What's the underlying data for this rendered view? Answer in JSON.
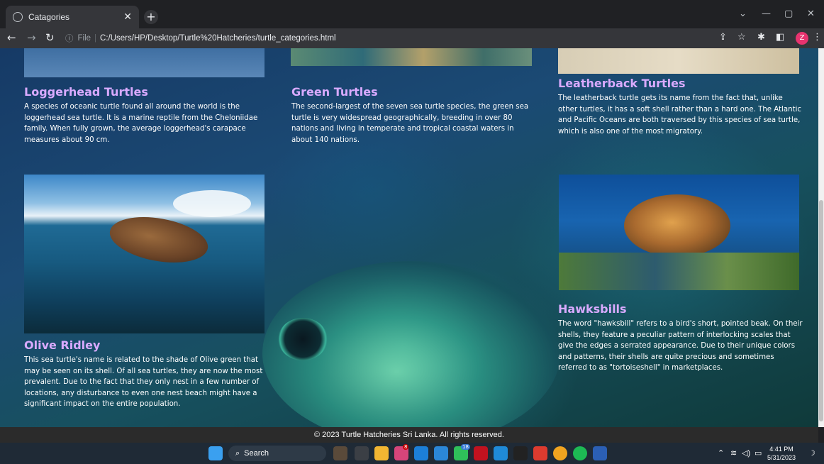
{
  "browser": {
    "tab_title": "Catagories",
    "new_tab_label": "+",
    "url_scheme": "File",
    "url": "C:/Users/HP/Desktop/Turtle%20Hatcheries/turtle_categories.html",
    "profile_initial": "Z"
  },
  "categories": {
    "loggerhead": {
      "title": "Loggerhead Turtles",
      "text": "A species of oceanic turtle found all around the world is the loggerhead sea turtle. It is a marine reptile from the Cheloniidae family. When fully grown, the average loggerhead's carapace measures about 90 cm."
    },
    "green": {
      "title": "Green Turtles",
      "text": "The second-largest of the seven sea turtle species, the green sea turtle is very widespread geographically, breeding in over 80 nations and living in temperate and tropical coastal waters in about 140 nations."
    },
    "leatherback": {
      "title": "Leatherback Turtles",
      "text": "The leatherback turtle gets its name from the fact that, unlike other turtles, it has a soft shell rather than a hard one. The Atlantic and Pacific Oceans are both traversed by this species of sea turtle, which is also one of the most migratory."
    },
    "olive": {
      "title": "Olive Ridley",
      "text": "This sea turtle's name is related to the shade of Olive green that may be seen on its shell. Of all sea turtles, they are now the most prevalent. Due to the fact that they only nest in a few number of locations, any disturbance to even one nest beach might have a significant impact on the entire population."
    },
    "hawksbill": {
      "title": "Hawksbills",
      "text": "The word \"hawksbill\" refers to a bird's short, pointed beak. On their shells, they feature a peculiar pattern of interlocking scales that give the edges a serrated appearance. Due to their unique colors and patterns, their shells are quite precious and sometimes referred to as \"tortoiseshell\" in marketplaces."
    }
  },
  "footer": {
    "text": "© 2023 Turtle Hatcheries Sri Lanka. All rights reserved."
  },
  "taskbar": {
    "search_label": "Search",
    "badge_instagram": "8",
    "badge_whatsapp": "18",
    "time": "4:41 PM",
    "date": "5/31/2023"
  },
  "colors": {
    "heading": "#d9aaff",
    "body_text": "#ffffff"
  }
}
